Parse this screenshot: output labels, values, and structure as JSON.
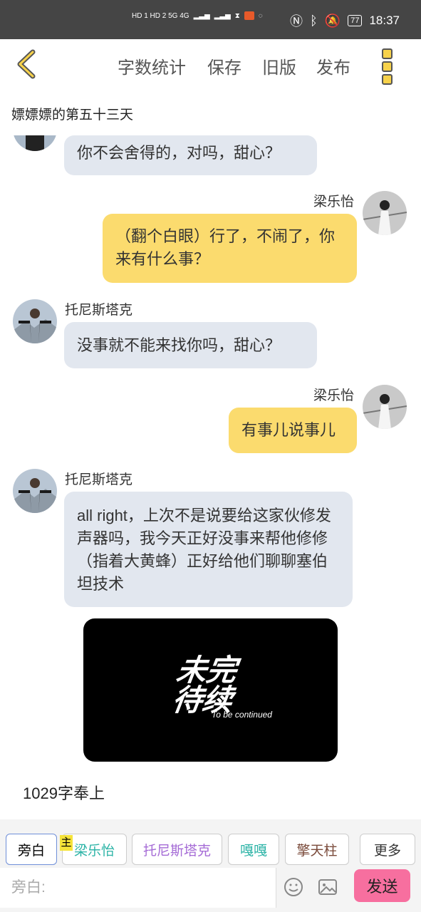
{
  "status": {
    "net_left": "HD 1 HD 2 5G 4G",
    "battery": "77",
    "time": "18:37"
  },
  "toolbar": {
    "word_count": "字数统计",
    "save": "保存",
    "old_version": "旧版",
    "publish": "发布"
  },
  "page": {
    "title": "嫖嫖嫖的第五十三天"
  },
  "messages": [
    {
      "side": "left",
      "name": "",
      "text": "你不会舍得的，对吗，甜心？"
    },
    {
      "side": "right",
      "name": "梁乐怡",
      "text": "（翻个白眼）行了，不闹了，你来有什么事？"
    },
    {
      "side": "left",
      "name": "托尼斯塔克",
      "text": "没事就不能来找你吗，甜心？"
    },
    {
      "side": "right",
      "name": "梁乐怡",
      "text": "有事儿说事儿"
    },
    {
      "side": "left",
      "name": "托尼斯塔克",
      "text": "all right，上次不是说要给这家伙修发声器吗，我今天正好没事来帮他修修（指着大黄蜂）正好给他们聊聊塞伯坦技术"
    }
  ],
  "tbc_image": {
    "cn": "未完待续",
    "en": "To be continued"
  },
  "endnote": "1029字奉上",
  "chips": {
    "narration": "旁白",
    "main_badge": "主",
    "c1": "梁乐怡",
    "c2": "托尼斯塔克",
    "c3": "嘎嘎",
    "c4": "擎天柱",
    "more": "更多"
  },
  "input": {
    "placeholder": "旁白:"
  },
  "send": "发送",
  "colors": {
    "accent_yellow": "#fbdb6e",
    "bubble_left": "#e2e7ef",
    "send_pink": "#f76f9f",
    "chip_teal": "#2bb3a6",
    "chip_purple": "#a56bd6",
    "chip_brown": "#7a4a3a"
  }
}
